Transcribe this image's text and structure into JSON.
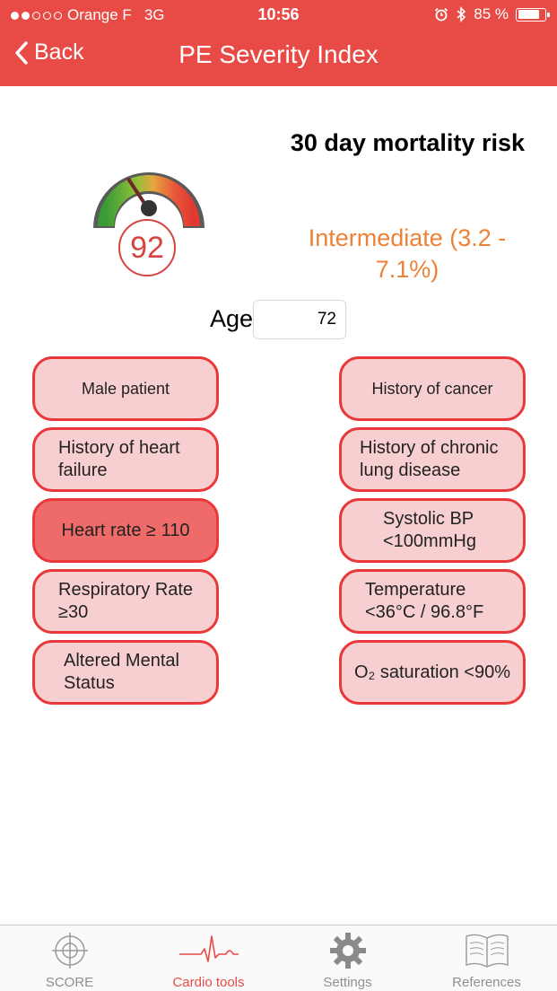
{
  "status_bar": {
    "carrier": "Orange F",
    "network": "3G",
    "time": "10:56",
    "battery": "85 %",
    "battery_level": 0.85
  },
  "nav": {
    "back_label": "Back",
    "title": "PE Severity Index"
  },
  "result": {
    "score": "92",
    "risk_title": "30 day mortality risk",
    "risk_value": "Intermediate (3.2 - 7.1%)",
    "risk_color": "#ec8236",
    "gauge_level": 0.62
  },
  "age": {
    "label": "Age",
    "value": "72"
  },
  "criteria": [
    {
      "label": "Male patient",
      "selected": false
    },
    {
      "label": "History of cancer",
      "selected": false
    },
    {
      "label": "History of heart failure",
      "selected": false
    },
    {
      "label": "History of chronic lung disease",
      "selected": false
    },
    {
      "label": "Heart rate ≥ 110",
      "selected": true
    },
    {
      "label": "Systolic BP <100mmHg",
      "selected": false
    },
    {
      "label": "Respiratory Rate ≥30",
      "selected": false
    },
    {
      "label": "Temperature <36°C / 96.8°F",
      "selected": false
    },
    {
      "label": "Altered Mental Status",
      "selected": false
    },
    {
      "label": "O₂ saturation <90%",
      "selected": false
    }
  ],
  "tabbar": {
    "tabs": [
      {
        "label": "SCORE",
        "icon": "crosshair-icon"
      },
      {
        "label": "Cardio tools",
        "icon": "ecg-icon"
      },
      {
        "label": "Settings",
        "icon": "gear-icon"
      },
      {
        "label": "References",
        "icon": "book-icon"
      }
    ],
    "selected": "Cardio tools"
  },
  "colors": {
    "accent": "#e84b45",
    "button_fill": "#f7cfd1",
    "button_active_fill": "#ef6b69",
    "button_border": "#e8383a"
  }
}
